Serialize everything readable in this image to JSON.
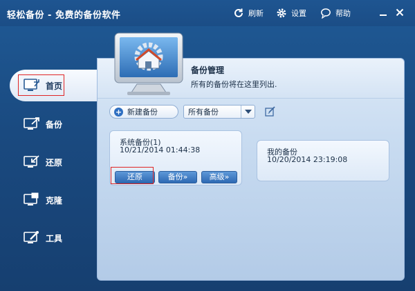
{
  "app": {
    "title": "轻松备份 - 免费的备份软件"
  },
  "top_actions": {
    "refresh": "刷新",
    "settings": "设置",
    "help": "帮助"
  },
  "sidebar": {
    "items": [
      {
        "label": "首页",
        "icon": "home-screen-icon",
        "active": true
      },
      {
        "label": "备份",
        "icon": "backup-icon"
      },
      {
        "label": "还原",
        "icon": "restore-icon"
      },
      {
        "label": "克隆",
        "icon": "clone-icon"
      },
      {
        "label": "工具",
        "icon": "tools-icon"
      }
    ]
  },
  "header": {
    "title": "备份管理",
    "subtitle": "所有的备份将在这里列出."
  },
  "toolbar": {
    "new_backup": "新建备份",
    "filter_value": "所有备份"
  },
  "backups": [
    {
      "name": "系统备份(1)",
      "time": "10/21/2014 01:44:38",
      "actions": {
        "restore": "还原",
        "backup": "备份",
        "advanced": "高级"
      }
    },
    {
      "name": "我的备份",
      "time": "10/20/2014 23:19:08"
    }
  ],
  "colors": {
    "window_blue": "#1b4f86",
    "panel_light": "#dbe8f6",
    "highlight_red": "#e02424",
    "button_blue": "#2d69b3"
  }
}
